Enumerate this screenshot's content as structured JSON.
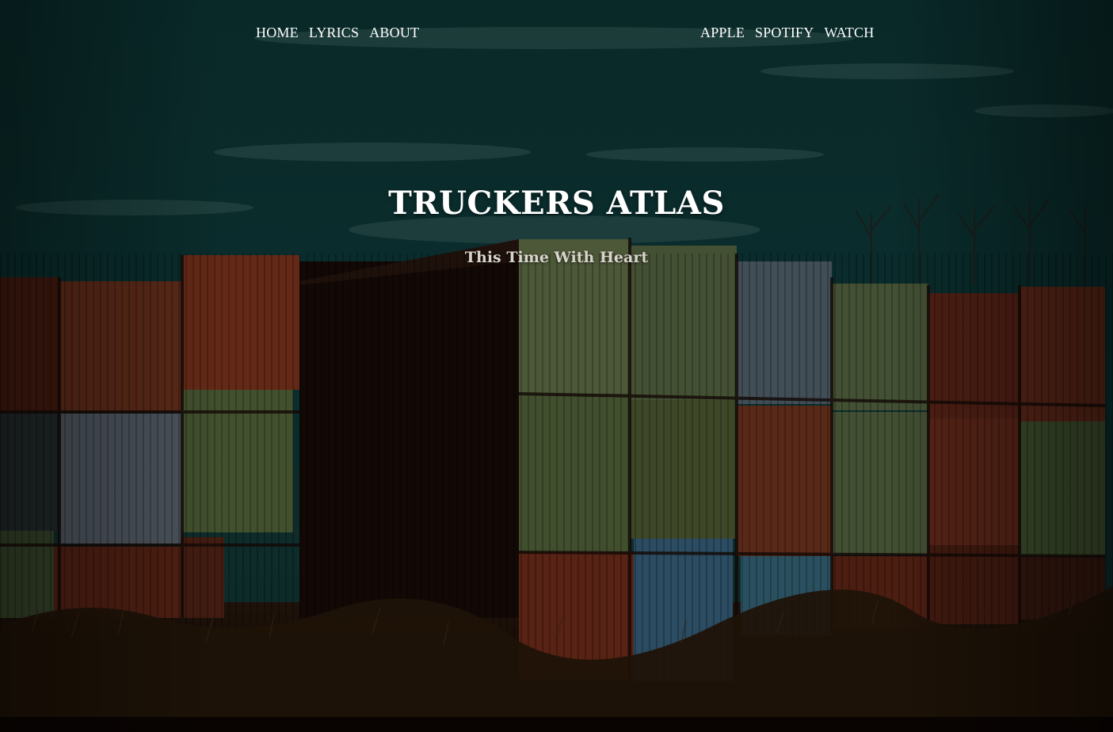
{
  "site": {
    "title": "TRUCKERS ATLAS",
    "tagline": "This Time With Heart"
  },
  "nav_left": [
    "HOME",
    "LYRICS",
    "ABOUT"
  ],
  "nav_right": [
    "APPLE",
    "SPOTIFY",
    "WATCH"
  ],
  "hero_image": "shipping-containers-stacked-under-dusk-sky",
  "colors": {
    "sky": "#0f3b3a",
    "container_red": "#8a2f1c",
    "container_green": "#5e7a4a",
    "container_blue": "#3f6f8c",
    "text": "#ffffff"
  }
}
